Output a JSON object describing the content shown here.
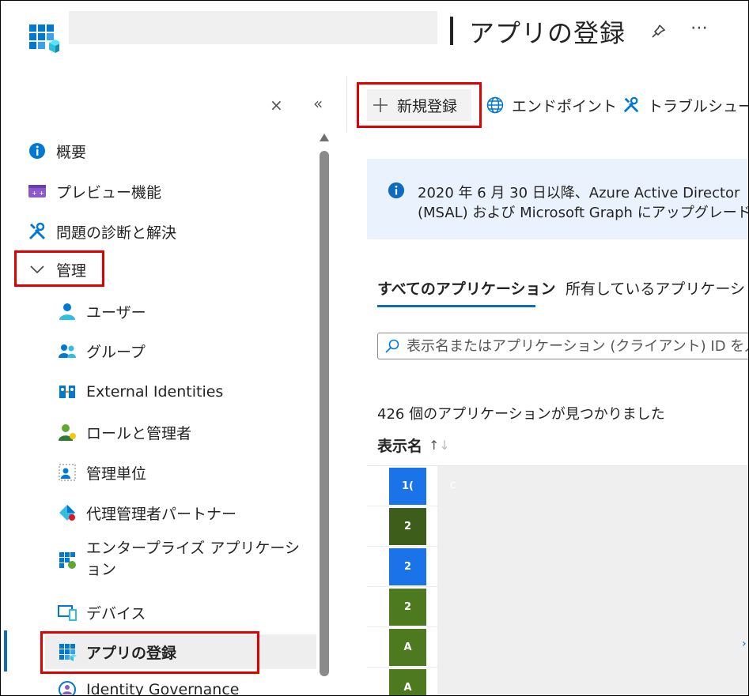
{
  "header": {
    "title": "アプリの登録",
    "pin": "pin-icon",
    "more": "⋯"
  },
  "sidebar": {
    "close_glyph": "×",
    "collapse_glyph": "«",
    "items": [
      {
        "label": "概要",
        "icon": "info-icon"
      },
      {
        "label": "プレビュー機能",
        "icon": "preview-icon"
      },
      {
        "label": "問題の診断と解決",
        "icon": "wrench-icon"
      },
      {
        "label": "管理",
        "icon": "chevron-down-icon"
      },
      {
        "label": "ユーザー",
        "icon": "user-icon"
      },
      {
        "label": "グループ",
        "icon": "group-icon"
      },
      {
        "label": "External Identities",
        "icon": "external-identities-icon"
      },
      {
        "label": "ロールと管理者",
        "icon": "roles-icon"
      },
      {
        "label": "管理単位",
        "icon": "admin-units-icon"
      },
      {
        "label": "代理管理者パートナー",
        "icon": "partner-icon"
      },
      {
        "label": "エンタープライズ アプリケーション",
        "label_line1": "エンタープライズ アプリケーシ",
        "label_line2": "ョン",
        "icon": "enterprise-apps-icon"
      },
      {
        "label": "デバイス",
        "icon": "devices-icon"
      },
      {
        "label": "アプリの登録",
        "icon": "app-registrations-icon",
        "selected": true
      },
      {
        "label": "Identity Governance",
        "icon": "identity-governance-icon"
      }
    ]
  },
  "toolbar": {
    "new_label": "新規登録",
    "endpoints_label": "エンドポイント",
    "troubleshoot_label": "トラブルシューテ"
  },
  "banner": {
    "line1": "2020 年 6 月 30 日以降、Azure Active Director",
    "line2": "(MSAL) および Microsoft Graph にアップグレードする"
  },
  "tabs": {
    "all": "すべてのアプリケーション",
    "owned": "所有しているアプリケーション"
  },
  "search": {
    "placeholder": "表示名またはアプリケーション (クライアント) ID を入力"
  },
  "results": {
    "count_text": "426 個のアプリケーションが見つかりました",
    "column_display_name": "表示名",
    "rows": [
      {
        "avatar": "1(",
        "color": "#1a73e8",
        "name": "C"
      },
      {
        "avatar": "2",
        "color": "#3d5e1b",
        "name": ""
      },
      {
        "avatar": "2",
        "color": "#1a73e8",
        "name": ""
      },
      {
        "avatar": "2",
        "color": "#4d7a1f",
        "name": ""
      },
      {
        "avatar": "A",
        "color": "#4d7a1f",
        "name": ""
      },
      {
        "avatar": "A",
        "color": "#4d7a1f",
        "name": ""
      }
    ]
  },
  "colors": {
    "accent": "#0f6cbd",
    "highlight_box": "#e00000",
    "banner_bg": "#eaf3fd"
  }
}
